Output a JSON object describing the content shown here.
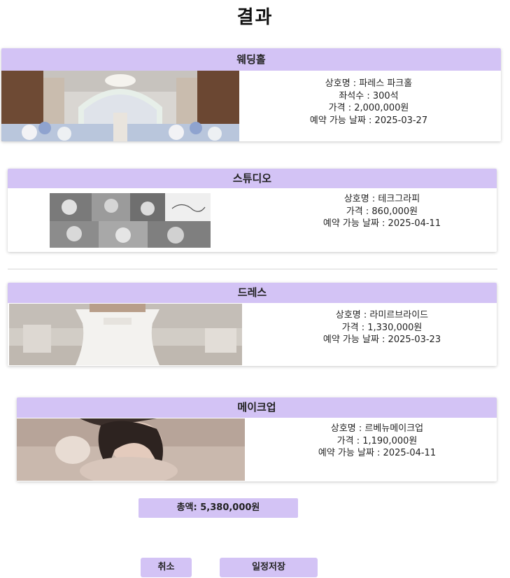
{
  "page": {
    "title": "결과"
  },
  "sections": [
    {
      "header": "웨딩홀",
      "lines": [
        "상호명 : 파레스 파크홀",
        "좌석수 : 300석",
        "가격 : 2,000,000원",
        "예약 가능 날짜 : 2025-03-27"
      ]
    },
    {
      "header": "스튜디오",
      "lines": [
        "상호명 : 테크그라피",
        "가격 : 860,000원",
        "예약 가능 날짜 : 2025-04-11"
      ]
    },
    {
      "header": "드레스",
      "lines": [
        "상호명 : 라미르브라이드",
        "가격 : 1,330,000원",
        "예약 가능 날짜 : 2025-03-23"
      ]
    },
    {
      "header": "메이크업",
      "lines": [
        "상호명 : 르베뉴메이크업",
        "가격 : 1,190,000원",
        "예약 가능 날짜 : 2025-04-11"
      ]
    }
  ],
  "total": {
    "label": "총액: 5,380,000원"
  },
  "buttons": {
    "cancel": "취소",
    "save": "일정저장"
  }
}
